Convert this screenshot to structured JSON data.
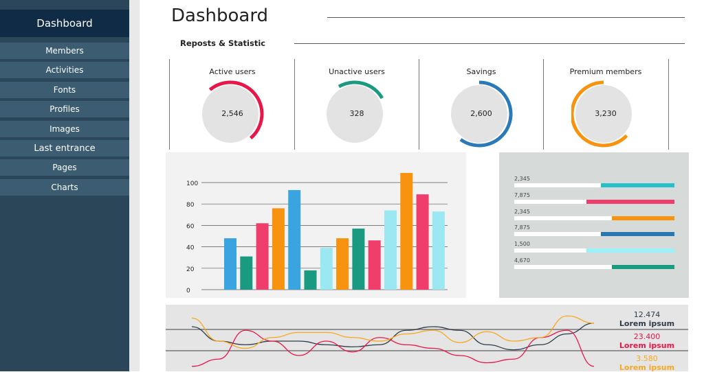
{
  "sidebar": {
    "header": "Dashboard",
    "items": [
      {
        "label": "Members"
      },
      {
        "label": "Activities"
      },
      {
        "label": "Fonts"
      },
      {
        "label": "Profiles"
      },
      {
        "label": "Images"
      },
      {
        "label": "Last entrance"
      },
      {
        "label": "Pages"
      },
      {
        "label": "Charts"
      }
    ]
  },
  "header": {
    "title": "Dashboard",
    "subtitle": "Reposts & Statistic"
  },
  "gauges": [
    {
      "label": "Active users",
      "value": "2,546",
      "color": "#e8174a",
      "fraction": 0.5
    },
    {
      "label": "Unactive users",
      "value": "328",
      "color": "#1a9a80",
      "fraction": 0.25
    },
    {
      "label": "Savings",
      "value": "2,600",
      "color": "#2a7ab8",
      "fraction": 0.6
    },
    {
      "label": "Premium members",
      "value": "3,230",
      "color": "#f7930e",
      "fraction": 0.63
    }
  ],
  "chart_data": [
    {
      "type": "bar",
      "yticks": [
        "100",
        "80",
        "60",
        "40",
        "20",
        "0"
      ],
      "ylim": [
        0,
        110
      ],
      "grid": true,
      "values": [
        48,
        31,
        62,
        76,
        93,
        18,
        39,
        48,
        57,
        46,
        74,
        109,
        89,
        73
      ],
      "colors": [
        "#3aa4e0",
        "#1a9a80",
        "#ef3e6b",
        "#f7930e",
        "#3aa4e0",
        "#1a9a80",
        "#9be8f2",
        "#f7930e",
        "#1a9a80",
        "#ef3e6b",
        "#9be8f2",
        "#f7930e",
        "#ef3e6b",
        "#9be8f2"
      ]
    },
    {
      "type": "line",
      "series": [
        {
          "values": [
            60,
            40,
            35,
            40,
            40,
            35,
            32,
            35,
            55,
            60,
            55,
            35,
            28,
            35,
            50,
            65
          ],
          "color": "#2d3c48",
          "value": "12.474",
          "name": "Lorem ipsum"
        },
        {
          "values": [
            5,
            15,
            55,
            40,
            20,
            40,
            25,
            45,
            35,
            30,
            20,
            10,
            15,
            45,
            55,
            5
          ],
          "color": "#e8174a",
          "value": "23.400",
          "name": "Lorem ipsum"
        },
        {
          "values": [
            72,
            40,
            30,
            45,
            52,
            52,
            45,
            40,
            50,
            55,
            38,
            53,
            40,
            45,
            75,
            65
          ],
          "color": "#f7a81e",
          "value": "3.580",
          "name": "Lorem ipsum"
        }
      ]
    }
  ],
  "progress": [
    {
      "value": "2,345",
      "fraction": 0.46,
      "color": "#27bfc9"
    },
    {
      "value": "7,875",
      "fraction": 0.55,
      "color": "#ef3e6b"
    },
    {
      "value": "2,345",
      "fraction": 0.39,
      "color": "#f7930e"
    },
    {
      "value": "7,875",
      "fraction": 0.46,
      "color": "#2a76b0"
    },
    {
      "value": "1,500",
      "fraction": 0.55,
      "color": "#9cf0f7"
    },
    {
      "value": "4,670",
      "fraction": 0.39,
      "color": "#1a9a80"
    }
  ]
}
